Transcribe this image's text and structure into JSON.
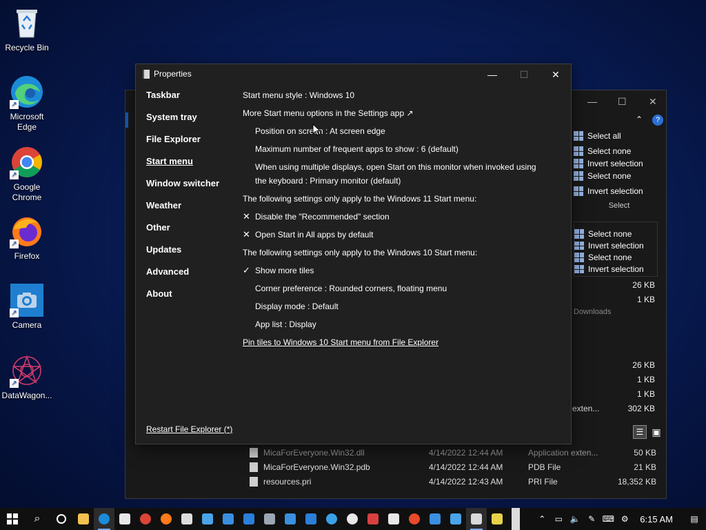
{
  "desktop": {
    "icons": [
      {
        "label": "Recycle Bin",
        "icon": "recycle-bin-icon"
      },
      {
        "label": "Microsoft Edge",
        "icon": "edge-icon"
      },
      {
        "label": "Google Chrome",
        "icon": "chrome-icon"
      },
      {
        "label": "Firefox",
        "icon": "firefox-icon"
      },
      {
        "label": "Camera",
        "icon": "camera-icon"
      },
      {
        "label": "DataWagon...",
        "icon": "datawagon-icon"
      }
    ]
  },
  "explorer": {
    "ribbon": {
      "select_all": "Select all",
      "select_none": "Select none",
      "invert_selection": "Invert selection",
      "group_label": "Select"
    },
    "sizes_top": [
      "26 KB",
      "1 KB"
    ],
    "downloads_label": "Downloads",
    "sizes_mid": [
      "26 KB",
      "1 KB",
      "1 KB",
      "302 KB"
    ],
    "partial_type": "exten...",
    "files": [
      {
        "name": "MicaForEveryone.Win32.dll",
        "date": "4/14/2022 12:44 AM",
        "type": "Application exten...",
        "size": "50 KB"
      },
      {
        "name": "MicaForEveryone.Win32.pdb",
        "date": "4/14/2022 12:44 AM",
        "type": "PDB File",
        "size": "21 KB"
      },
      {
        "name": "resources.pri",
        "date": "4/14/2022 12:43 AM",
        "type": "PRI File",
        "size": "18,352 KB"
      }
    ]
  },
  "dialog": {
    "title": "Properties",
    "nav": [
      {
        "label": "Taskbar",
        "active": false
      },
      {
        "label": "System tray",
        "active": false
      },
      {
        "label": "File Explorer",
        "active": false
      },
      {
        "label": "Start menu",
        "active": true
      },
      {
        "label": "Window switcher",
        "active": false
      },
      {
        "label": "Weather",
        "active": false
      },
      {
        "label": "Other",
        "active": false
      },
      {
        "label": "Updates",
        "active": false
      },
      {
        "label": "Advanced",
        "active": false
      },
      {
        "label": "About",
        "active": false
      }
    ],
    "restart_label": "Restart File Explorer (*)",
    "settings": {
      "start_menu_style": "Start menu style : Windows 10",
      "more_options": "More Start menu options in the Settings app ↗",
      "position": "Position on screen : At screen edge",
      "max_frequent": "Maximum number of frequent apps to show : 6 (default)",
      "multi_display": "When using multiple displays, open Start on this monitor when invoked using the keyboard : Primary monitor (default)",
      "win11_header": "The following settings only apply to the Windows 11 Start menu:",
      "disable_recommended": "Disable the \"Recommended\" section",
      "open_all_apps": "Open Start in All apps by default",
      "win10_header": "The following settings only apply to the Windows 10 Start menu:",
      "show_more_tiles": "Show more tiles",
      "corner_pref": "Corner preference : Rounded corners, floating menu",
      "display_mode": "Display mode : Default",
      "app_list": "App list : Display",
      "pin_tiles": "Pin tiles to Windows 10 Start menu from File Explorer"
    },
    "marks": {
      "cross": "✕",
      "check": "✓"
    }
  },
  "taskbar": {
    "clock": "6:15 AM"
  }
}
